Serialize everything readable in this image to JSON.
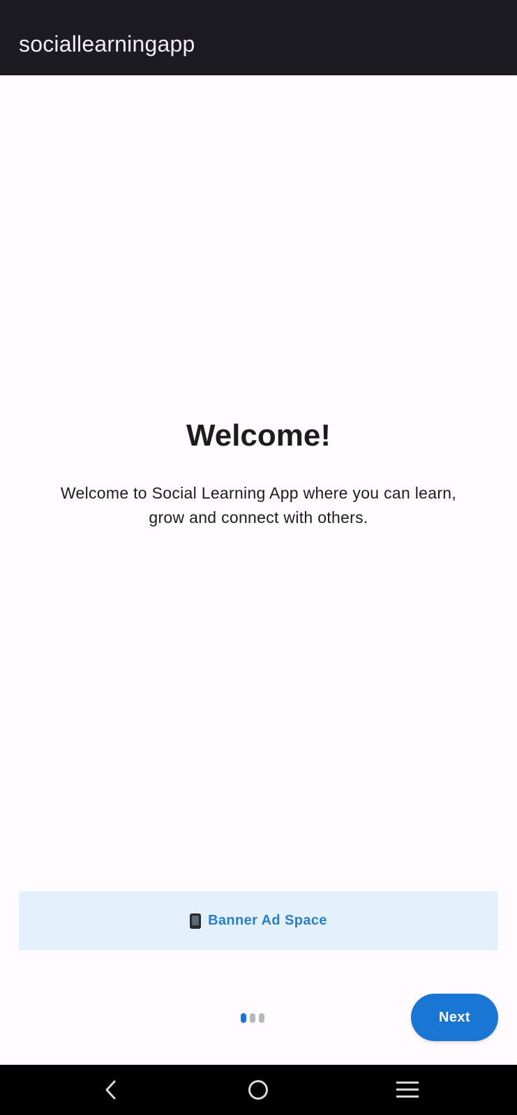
{
  "app_bar": {
    "title": "sociallearningapp"
  },
  "onboarding": {
    "title": "Welcome!",
    "description": "Welcome to Social Learning App where you can learn, grow and connect with others.",
    "page_indicator": {
      "total": 3,
      "current": 1
    },
    "next_label": "Next"
  },
  "banner": {
    "icon": "mobile-phone-icon",
    "label": "Banner Ad Space"
  },
  "nav_bar": {
    "items": [
      "back-icon",
      "home-icon",
      "recent-apps-icon"
    ]
  },
  "colors": {
    "app_bar": "#1c1b20",
    "background": "#fffbfe",
    "accent": "#1976d2",
    "banner_bg": "#e3f1fb",
    "banner_text": "#2a7fc6"
  }
}
